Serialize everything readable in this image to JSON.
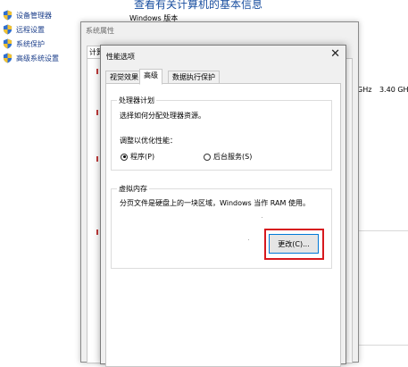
{
  "control_panel": {
    "header": "查看有关计算机的基本信息",
    "windows_edition": "Windows 版本",
    "links": [
      {
        "label": "设备管理器",
        "icon": "shield-icon"
      },
      {
        "label": "远程设置",
        "icon": "shield-icon"
      },
      {
        "label": "系统保护",
        "icon": "shield-icon"
      },
      {
        "label": "高级系统设置",
        "icon": "shield-icon"
      }
    ],
    "cpu_ghz_fragment": "GHz",
    "cpu_speed": "3.40 GHz"
  },
  "system_properties": {
    "title": "系统属性",
    "tab_fragment": "计算"
  },
  "performance_options": {
    "title": "性能选项",
    "close_symbol": "✕",
    "tabs": [
      {
        "label": "视觉效果",
        "selected": false
      },
      {
        "label": "高级",
        "selected": true
      },
      {
        "label": "数据执行保护",
        "selected": false
      }
    ],
    "processor_group": {
      "legend": "处理器计划",
      "description": "选择如何分配处理器资源。",
      "adjust_label": "调整以优化性能：",
      "options": [
        {
          "label": "程序(P)",
          "checked": true
        },
        {
          "label": "后台服务(S)",
          "checked": false
        }
      ]
    },
    "virtual_memory_group": {
      "legend": "虚拟内存",
      "description": "分页文件是硬盘上的一块区域，Windows 当作 RAM 使用。",
      "change_button": "更改(C)..."
    }
  },
  "colors": {
    "accent_link": "#1a3d8a",
    "highlight_red": "#d7191e",
    "button_focus": "#0078d7"
  }
}
